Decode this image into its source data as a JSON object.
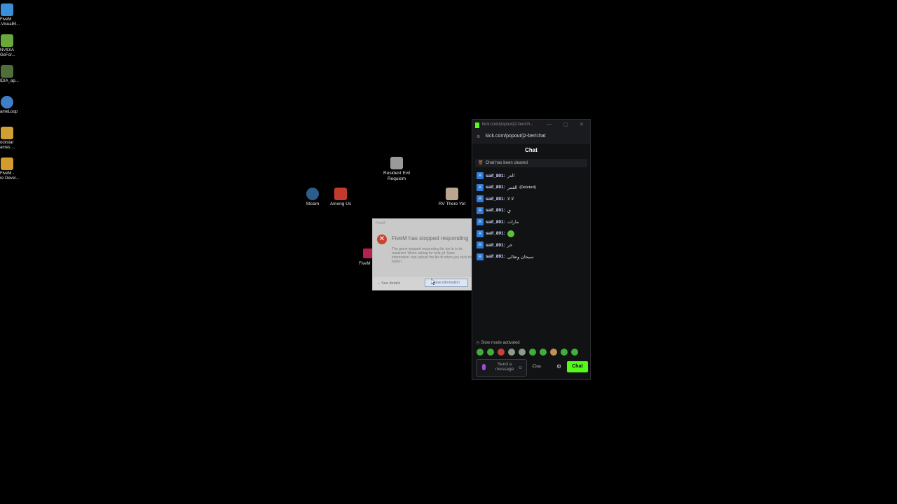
{
  "desktop_left": [
    {
      "label": "FiveM\n.VisualEl...",
      "color": "#3a8fd6"
    },
    {
      "label": "NVIDIA\nGeFor...",
      "color": "#6aa83a"
    },
    {
      "label": "IDIA_ap...",
      "color": "#4f6f3a"
    },
    {
      "label": "ameLoop",
      "color": "#3f7fc9"
    },
    {
      "label": "ockstar\names ...",
      "color": "#d0a035"
    },
    {
      "label": "FiveM -\nre Devel...",
      "color": "#d39a2d"
    }
  ],
  "desktop_icons": [
    {
      "label": "Resident Evil\nRequiem",
      "color": "#9a9a9a"
    },
    {
      "label": "Steam",
      "color": "#2b5e8a"
    },
    {
      "label": "Among Us",
      "color": "#c23a2d"
    },
    {
      "label": "RV There Yet",
      "color": "#b9a590"
    },
    {
      "label": "FiveM",
      "color": "#b6204a"
    }
  ],
  "crash": {
    "window_title": "FiveM",
    "heading": "FiveM has stopped responding",
    "body": "The game stopped responding for too lo to be restarted. When asking for help, pl 'Save information' and upload the file th when you click the button.",
    "details": "See details",
    "save_button": "Save information"
  },
  "chat_window": {
    "title_url": "kick.com/popout/j2-ber/ch...",
    "address": "kick.com/popout/j2-ber/chat",
    "header": "Chat",
    "cleared": "Chat has been cleared",
    "messages": [
      {
        "user": "saif_891:",
        "text": "الدر"
      },
      {
        "user": "saif_891:",
        "text": "القمر",
        "deleted": "(Deleted)"
      },
      {
        "user": "saif_891:",
        "text": "لا لا"
      },
      {
        "user": "saif_891:",
        "text": "ي"
      },
      {
        "user": "saif_891:",
        "text": "مارات"
      },
      {
        "user": "saif_891:",
        "text": "",
        "emote": true
      },
      {
        "user": "saif_891:",
        "text": "خر"
      },
      {
        "user": "saif_891:",
        "text": "سبحان وتعالى"
      }
    ],
    "slow_mode": "Slow mode activated",
    "input_placeholder": "Send a message",
    "chat_button": "Chat",
    "accent": "#53fc18"
  }
}
